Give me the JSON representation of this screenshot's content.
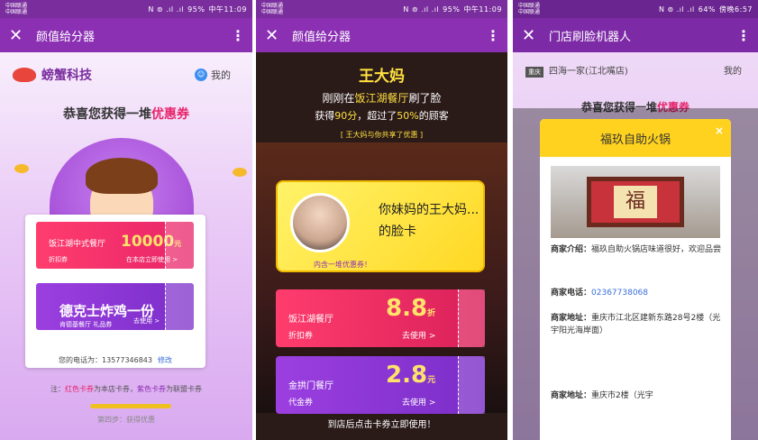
{
  "phone1": {
    "status": {
      "carrier": "中国联通\n中国联通",
      "battery": "95%",
      "time": "中午11:09",
      "icons": "N ⊚ .ıl .ıl"
    },
    "title": "颜值给分器",
    "brand": "螃蟹科技",
    "me": "我的",
    "congrats_prefix": "恭喜您获得一堆",
    "congrats_highlight": "优惠券",
    "coupon1": {
      "name": "饭江湖中式餐厅",
      "type": "折扣券",
      "amount": "10000",
      "unit": "元",
      "use": "在本店立即使用 >"
    },
    "coupon2": {
      "name": "德克士炸鸡一份",
      "type": "肯德基餐厅",
      "type2": "礼品券",
      "use": "去使用 >"
    },
    "phone_label": "您的电话为：13577346843",
    "edit": "修改",
    "note_prefix": "注：",
    "note_red": "红色卡券",
    "note_mid": "为本店卡券，",
    "note_purple": "紫色卡券",
    "note_suffix": "为联盟卡券",
    "step": "第四步：获得优惠"
  },
  "phone2": {
    "status": {
      "carrier": "中国联通\n中国联通",
      "battery": "95%",
      "time": "中午11:09"
    },
    "title": "颜值给分器",
    "name": "王大妈",
    "line2_prefix": "刚刚在",
    "line2_hl": "饭江湖餐厅",
    "line2_suffix": "刷了脸",
    "line3_prefix": "获得",
    "line3_score": "90分",
    "line3_mid": "，超过了",
    "line3_pct": "50%",
    "line3_suffix": "的顾客",
    "line4": "[ 王大妈与你共享了优惠 ]",
    "card_t1": "你妹妈的王大妈...",
    "card_t2": "的脸卡",
    "card_t3": "内含一堆优惠券！",
    "coupon1": {
      "name": "饭江湖餐厅",
      "type": "折扣券",
      "amount": "8.8",
      "unit": "折",
      "use": "去使用 >"
    },
    "coupon2": {
      "name": "金拱门餐厅",
      "type": "代金券",
      "amount": "2.8",
      "unit": "元",
      "use": "去使用 >"
    },
    "cta": "到店后点击卡券立即使用！"
  },
  "phone3": {
    "status": {
      "carrier": "中国联通\n中国联通",
      "battery": "64%",
      "time": "傍晚6:57"
    },
    "title": "门店刷脸机器人",
    "store_mark": "重庆",
    "store": "四海一家(江北嘴店)",
    "me": "我的",
    "congrats_prefix": "恭喜您获得一堆",
    "congrats_highlight": "优惠券",
    "modal_title": "福玖自助火锅",
    "close": "×",
    "sign": "福",
    "intro_label": "商家介绍：",
    "intro": "福玖自助火锅店味道很好，欢迎品尝",
    "tel_label": "商家电话：",
    "tel": "02367738068",
    "addr_label": "商家地址：",
    "addr": "重庆市江北区建新东路28号2楼（光宇阳光海岸面）",
    "addr2_label": "商家地址：",
    "addr2": "重庆市2楼（光宇"
  }
}
